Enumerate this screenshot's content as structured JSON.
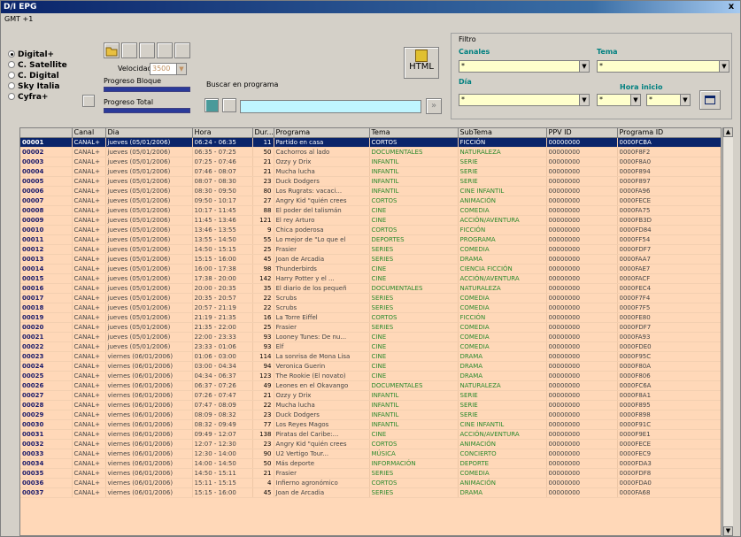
{
  "window": {
    "title": "D/I EPG",
    "close": "x",
    "menu": "GMT +1"
  },
  "sources": [
    "Digital+",
    "C. Satellite",
    "C. Digital",
    "Sky Italia",
    "Cyfra+"
  ],
  "selected_source": 0,
  "controls": {
    "velocidad_label": "Velocidad",
    "velocidad_value": "3500",
    "progreso_bloque": "Progreso Bloque",
    "progreso_total": "Progreso Total",
    "buscar_label": "Buscar en programa",
    "html_button": "HTML"
  },
  "filtro": {
    "title": "Filtro",
    "canales": "Canales",
    "tema": "Tema",
    "dia": "Día",
    "hora_inicio": "Hora inicio",
    "canales_value": "*",
    "tema_value": "*",
    "dia_value": "*",
    "hora_a": "*",
    "hora_b": "*"
  },
  "columns": [
    "",
    "Canal",
    "Dia",
    "Hora",
    "Dur...",
    "Programa",
    "Tema",
    "SubTema",
    "PPV ID",
    "Programa ID"
  ],
  "rows": [
    [
      "00001",
      "CANAL+",
      "jueves (05/01/2006)",
      "06:24 - 06:35",
      "11",
      "Partido en casa",
      "CORTOS",
      "FICCIÓN",
      "00000000",
      "0000FCBA"
    ],
    [
      "00002",
      "CANAL+",
      "jueves (05/01/2006)",
      "06:35 - 07:25",
      "50",
      "Cachorros al lado",
      "DOCUMENTALES",
      "NATURALEZA",
      "00000000",
      "0000F8F2"
    ],
    [
      "00003",
      "CANAL+",
      "jueves (05/01/2006)",
      "07:25 - 07:46",
      "21",
      "Ozzy y Drix",
      "INFANTIL",
      "SERIE",
      "00000000",
      "0000F8A0"
    ],
    [
      "00004",
      "CANAL+",
      "jueves (05/01/2006)",
      "07:46 - 08:07",
      "21",
      "Mucha lucha",
      "INFANTIL",
      "SERIE",
      "00000000",
      "0000F894"
    ],
    [
      "00005",
      "CANAL+",
      "jueves (05/01/2006)",
      "08:07 - 08:30",
      "23",
      "Duck Dodgers",
      "INFANTIL",
      "SERIE",
      "00000000",
      "0000F897"
    ],
    [
      "00006",
      "CANAL+",
      "jueves (05/01/2006)",
      "08:30 - 09:50",
      "80",
      "Los Rugrats: vacaci...",
      "INFANTIL",
      "CINE INFANTIL",
      "00000000",
      "0000FA96"
    ],
    [
      "00007",
      "CANAL+",
      "jueves (05/01/2006)",
      "09:50 - 10:17",
      "27",
      "Angry Kid \"quién crees",
      "CORTOS",
      "ANIMACIÓN",
      "00000000",
      "0000FECE"
    ],
    [
      "00008",
      "CANAL+",
      "jueves (05/01/2006)",
      "10:17 - 11:45",
      "88",
      "El poder del talismán",
      "CINE",
      "COMEDIA",
      "00000000",
      "0000FA75"
    ],
    [
      "00009",
      "CANAL+",
      "jueves (05/01/2006)",
      "11:45 - 13:46",
      "121",
      "El rey Arturo",
      "CINE",
      "ACCIÓN/AVENTURA",
      "00000000",
      "0000FB3D"
    ],
    [
      "00010",
      "CANAL+",
      "jueves (05/01/2006)",
      "13:46 - 13:55",
      "9",
      "Chica poderosa",
      "CORTOS",
      "FICCIÓN",
      "00000000",
      "0000FD84"
    ],
    [
      "00011",
      "CANAL+",
      "jueves (05/01/2006)",
      "13:55 - 14:50",
      "55",
      "Lo mejor de \"Lo que el",
      "DEPORTES",
      "PROGRAMA",
      "00000000",
      "0000FF54"
    ],
    [
      "00012",
      "CANAL+",
      "jueves (05/01/2006)",
      "14:50 - 15:15",
      "25",
      "Frasier",
      "SERIES",
      "COMEDIA",
      "00000000",
      "0000FDF7"
    ],
    [
      "00013",
      "CANAL+",
      "jueves (05/01/2006)",
      "15:15 - 16:00",
      "45",
      "Joan de Arcadia",
      "SERIES",
      "DRAMA",
      "00000000",
      "0000FAA7"
    ],
    [
      "00014",
      "CANAL+",
      "jueves (05/01/2006)",
      "16:00 - 17:38",
      "98",
      "Thunderbirds",
      "CINE",
      "CIENCIA FICCIÓN",
      "00000000",
      "0000FAE7"
    ],
    [
      "00015",
      "CANAL+",
      "jueves (05/01/2006)",
      "17:38 - 20:00",
      "142",
      "Harry Potter y el ...",
      "CINE",
      "ACCIÓN/AVENTURA",
      "00000000",
      "0000FACF"
    ],
    [
      "00016",
      "CANAL+",
      "jueves (05/01/2006)",
      "20:00 - 20:35",
      "35",
      "El diario de los pequeñ",
      "DOCUMENTALES",
      "NATURALEZA",
      "00000000",
      "0000FEC4"
    ],
    [
      "00017",
      "CANAL+",
      "jueves (05/01/2006)",
      "20:35 - 20:57",
      "22",
      "Scrubs",
      "SERIES",
      "COMEDIA",
      "00000000",
      "0000F7F4"
    ],
    [
      "00018",
      "CANAL+",
      "jueves (05/01/2006)",
      "20:57 - 21:19",
      "22",
      "Scrubs",
      "SERIES",
      "COMEDIA",
      "00000000",
      "0000F7F5"
    ],
    [
      "00019",
      "CANAL+",
      "jueves (05/01/2006)",
      "21:19 - 21:35",
      "16",
      "La Torre Eiffel",
      "CORTOS",
      "FICCIÓN",
      "00000000",
      "0000FE80"
    ],
    [
      "00020",
      "CANAL+",
      "jueves (05/01/2006)",
      "21:35 - 22:00",
      "25",
      "Frasier",
      "SERIES",
      "COMEDIA",
      "00000000",
      "0000FDF7"
    ],
    [
      "00021",
      "CANAL+",
      "jueves (05/01/2006)",
      "22:00 - 23:33",
      "93",
      "Looney Tunes: De nu...",
      "CINE",
      "COMEDIA",
      "00000000",
      "0000FA93"
    ],
    [
      "00022",
      "CANAL+",
      "jueves (05/01/2006)",
      "23:33 - 01:06",
      "93",
      "Elf",
      "CINE",
      "COMEDIA",
      "00000000",
      "0000FDE0"
    ],
    [
      "00023",
      "CANAL+",
      "viernes (06/01/2006)",
      "01:06 - 03:00",
      "114",
      "La sonrisa de Mona Lisa",
      "CINE",
      "DRAMA",
      "00000000",
      "0000F95C"
    ],
    [
      "00024",
      "CANAL+",
      "viernes (06/01/2006)",
      "03:00 - 04:34",
      "94",
      "Veronica Guerin",
      "CINE",
      "DRAMA",
      "00000000",
      "0000F80A"
    ],
    [
      "00025",
      "CANAL+",
      "viernes (06/01/2006)",
      "04:34 - 06:37",
      "123",
      "The Rookie (El novato)",
      "CINE",
      "DRAMA",
      "00000000",
      "0000F806"
    ],
    [
      "00026",
      "CANAL+",
      "viernes (06/01/2006)",
      "06:37 - 07:26",
      "49",
      "Leones en el Okavango",
      "DOCUMENTALES",
      "NATURALEZA",
      "00000000",
      "0000FC6A"
    ],
    [
      "00027",
      "CANAL+",
      "viernes (06/01/2006)",
      "07:26 - 07:47",
      "21",
      "Ozzy y Drix",
      "INFANTIL",
      "SERIE",
      "00000000",
      "0000F8A1"
    ],
    [
      "00028",
      "CANAL+",
      "viernes (06/01/2006)",
      "07:47 - 08:09",
      "22",
      "Mucha lucha",
      "INFANTIL",
      "SERIE",
      "00000000",
      "0000F895"
    ],
    [
      "00029",
      "CANAL+",
      "viernes (06/01/2006)",
      "08:09 - 08:32",
      "23",
      "Duck Dodgers",
      "INFANTIL",
      "SERIE",
      "00000000",
      "0000F898"
    ],
    [
      "00030",
      "CANAL+",
      "viernes (06/01/2006)",
      "08:32 - 09:49",
      "77",
      "Los Reyes Magos",
      "INFANTIL",
      "CINE INFANTIL",
      "00000000",
      "0000F91C"
    ],
    [
      "00031",
      "CANAL+",
      "viernes (06/01/2006)",
      "09:49 - 12:07",
      "138",
      "Piratas del Caribe:...",
      "CINE",
      "ACCIÓN/AVENTURA",
      "00000000",
      "0000F9E1"
    ],
    [
      "00032",
      "CANAL+",
      "viernes (06/01/2006)",
      "12:07 - 12:30",
      "23",
      "Angry Kid \"quién crees",
      "CORTOS",
      "ANIMACIÓN",
      "00000000",
      "0000FECE"
    ],
    [
      "00033",
      "CANAL+",
      "viernes (06/01/2006)",
      "12:30 - 14:00",
      "90",
      "U2 Vertigo Tour...",
      "MÚSICA",
      "CONCIERTO",
      "00000000",
      "0000FEC9"
    ],
    [
      "00034",
      "CANAL+",
      "viernes (06/01/2006)",
      "14:00 - 14:50",
      "50",
      "Más deporte",
      "INFORMACIÓN",
      "DEPORTE",
      "00000000",
      "0000FDA3"
    ],
    [
      "00035",
      "CANAL+",
      "viernes (06/01/2006)",
      "14:50 - 15:11",
      "21",
      "Frasier",
      "SERIES",
      "COMEDIA",
      "00000000",
      "0000FDF8"
    ],
    [
      "00036",
      "CANAL+",
      "viernes (06/01/2006)",
      "15:11 - 15:15",
      "4",
      "Infierno agronómico",
      "CORTOS",
      "ANIMACIÓN",
      "00000000",
      "0000FDA0"
    ],
    [
      "00037",
      "CANAL+",
      "viernes (06/01/2006)",
      "15:15 - 16:00",
      "45",
      "Joan de Arcadia",
      "SERIES",
      "DRAMA",
      "00000000",
      "0000FA68"
    ]
  ],
  "colors": {
    "selected_row": "#0a246a",
    "grid_bg": "#ffd8b8",
    "tema_text": "#2c8a2c"
  }
}
